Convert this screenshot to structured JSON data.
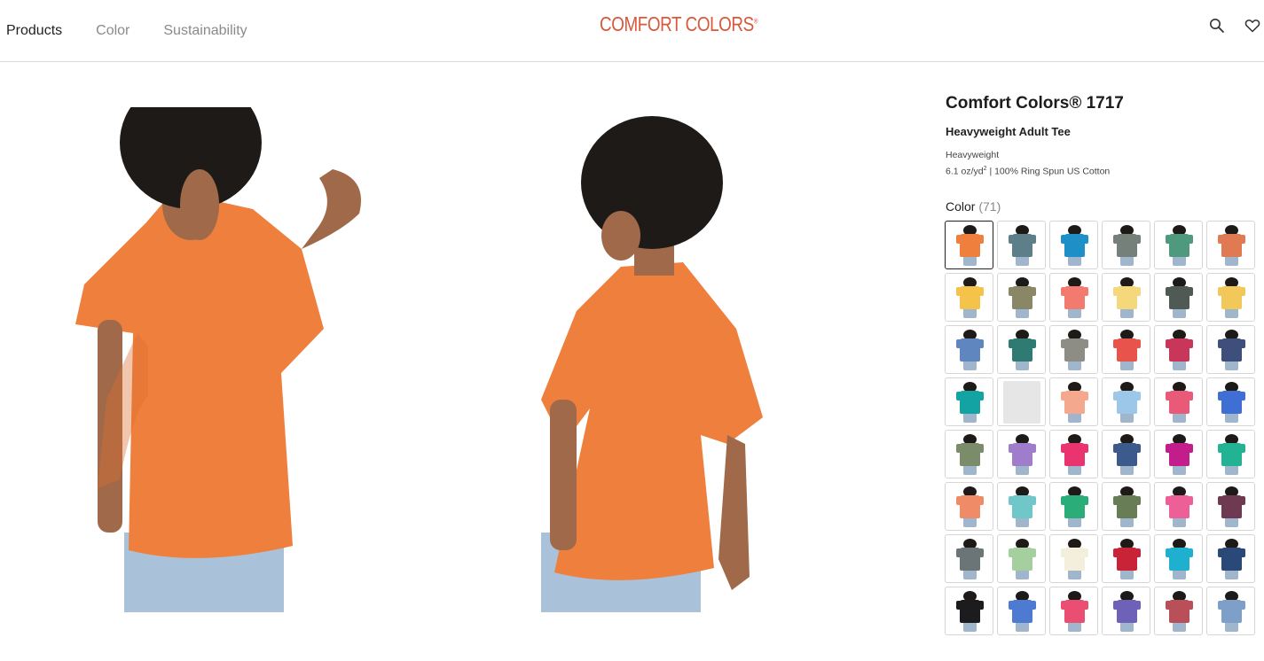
{
  "header": {
    "nav": [
      "Products",
      "Color",
      "Sustainability"
    ],
    "logo": "COMFORT COLORS",
    "logo_mark": "®",
    "icons": [
      "search-icon",
      "heart-icon"
    ]
  },
  "product": {
    "title": "Comfort Colors® 1717",
    "subtitle": "Heavyweight Adult Tee",
    "weight_label": "Heavyweight",
    "fabric_prefix": "6.1 oz/yd",
    "fabric_sup": "2",
    "fabric_suffix": " | 100% Ring Spun US Cotton",
    "color_label": "Color",
    "color_count": "(71)"
  },
  "colors": {
    "shirt_main": "#ee7f3c",
    "brand": "#d9573a",
    "swatches": [
      "#ee7f3c",
      "#5d7f8a",
      "#1f8fc7",
      "#75807a",
      "#4f9a7f",
      "#df7a53",
      "#f5c34a",
      "#8a8766",
      "#f37a6e",
      "#f6d87c",
      "#4f5a55",
      "#f2c85a",
      "#5f86bf",
      "#2f7a73",
      "#8d8d86",
      "#e8544b",
      "#c8375a",
      "#3d4f7a",
      "#13a3a3",
      "PLACEHOLDER",
      "#f4a98e",
      "#9cc7e8",
      "#e95a78",
      "#3f6fd4",
      "#7a8c6a",
      "#a07ccc",
      "#e9346f",
      "#3c5b8c",
      "#c21d8a",
      "#22b394",
      "#ef8c67",
      "#6fc7c9",
      "#2aad78",
      "#687c56",
      "#ec5f97",
      "#6d3a52",
      "#6b7578",
      "#a6cfa0",
      "#f4efdc",
      "#c92338",
      "#1fb0cf",
      "#2a4878",
      "#1c1c1f",
      "#4c7bd1",
      "#ea4e72",
      "#6e62b8",
      "#b94f58",
      "#7e9fc8"
    ]
  }
}
